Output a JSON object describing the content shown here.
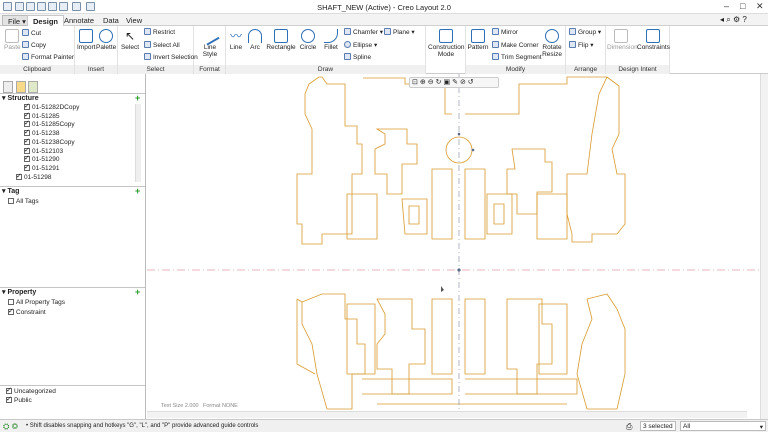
{
  "window": {
    "title": "SHAFT_NEW (Active) - Creo Layout 2.0"
  },
  "file_menu": {
    "label": "File"
  },
  "tabs": [
    {
      "label": "Design",
      "active": true
    },
    {
      "label": "Annotate",
      "active": false
    },
    {
      "label": "Data",
      "active": false
    },
    {
      "label": "View",
      "active": false
    }
  ],
  "ribbon": {
    "clipboard": {
      "label": "Clipboard",
      "paste": "Paste",
      "cut": "Cut",
      "copy": "Copy",
      "format_painter": "Format Painter"
    },
    "insert": {
      "label": "Insert",
      "import": "Import",
      "palette": "Palette"
    },
    "select": {
      "label": "Select",
      "select": "Select",
      "restrict": "Restrict",
      "select_all": "Select All",
      "invert": "Invert Selection"
    },
    "format": {
      "label": "Format",
      "line_style": "Line Style"
    },
    "draw": {
      "label": "Draw",
      "line": "Line",
      "arc": "Arc",
      "rectangle": "Rectangle",
      "circle": "Circle",
      "fillet": "Fillet",
      "chamfer": "Chamfer",
      "plane": "Plane",
      "ellipse": "Ellipse",
      "spline": "Spline"
    },
    "construction": {
      "label": "Construction Mode"
    },
    "modify": {
      "label": "Modify",
      "pattern": "Pattern",
      "mirror": "Mirror",
      "make_corner": "Make Corner",
      "trim_segment": "Trim Segment",
      "rotate_resize": "Rotate Resize"
    },
    "arrange": {
      "label": "Arrange",
      "group": "Group",
      "flip": "Flip"
    },
    "design_intent": {
      "label": "Design Intent",
      "dimension": "Dimension",
      "constraints": "Constraints"
    }
  },
  "structure": {
    "title": "Structure",
    "items": [
      "01-51282DCopy",
      "01-51285",
      "01-51285Copy",
      "01-51238",
      "01-51238Copy",
      "01-512103",
      "01-51290",
      "01-51291",
      "01-51298"
    ]
  },
  "tag": {
    "title": "Tag",
    "items": [
      "All Tags"
    ]
  },
  "property": {
    "title": "Property",
    "items": [
      "All Property Tags",
      "Constraint"
    ]
  },
  "layers": {
    "items": [
      "Uncategorized",
      "Public"
    ]
  },
  "canvas": {
    "text_size": "Text Size 2.000",
    "format": "Format NONE",
    "line_color": "#d89a2c"
  },
  "status": {
    "hint": "Shift disables snapping and hotkeys \"G\", \"L\", and \"P\" provide advanced guide controls",
    "selected": "3 selected",
    "filter": "All"
  }
}
